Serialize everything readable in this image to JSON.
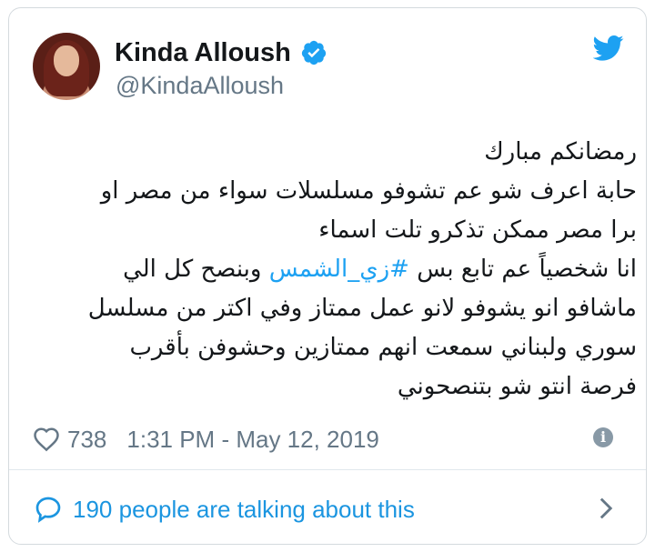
{
  "user": {
    "display_name": "Kinda Alloush",
    "handle": "@KindaAlloush",
    "verified_icon": "verified-badge-icon",
    "avatar_icon": "profile-avatar"
  },
  "tweet": {
    "lines": [
      "رمضانكم مبارك",
      "حابة اعرف شو عم تشوفو مسلسلات سواء من مصر او",
      "برا مصر ممكن تذكرو تلت اسماء",
      "انا شخصياً عم تابع بس",
      "ماشافو انو يشوفو لانو عمل ممتاز وفي اكتر من مسلسل",
      "سوري ولبناني سمعت انهم ممتازين وحشوفن بأقرب",
      "فرصة انتو شو بتنصحوني"
    ],
    "hashtag": "#زي_الشمس",
    "line4_after": "وبنصح كل الي"
  },
  "meta": {
    "likes": "738",
    "timestamp": "1:31 PM - May 12, 2019",
    "heart_icon": "heart-icon",
    "info_icon": "info-icon",
    "info_glyph": "i"
  },
  "conversation": {
    "text": "190 people are talking about this",
    "bubble_icon": "speech-bubble-icon",
    "chevron_icon": "chevron-right-icon"
  },
  "colors": {
    "accent": "#1da1f2",
    "link": "#1b95e0",
    "muted": "#657786",
    "text": "#14171a"
  }
}
